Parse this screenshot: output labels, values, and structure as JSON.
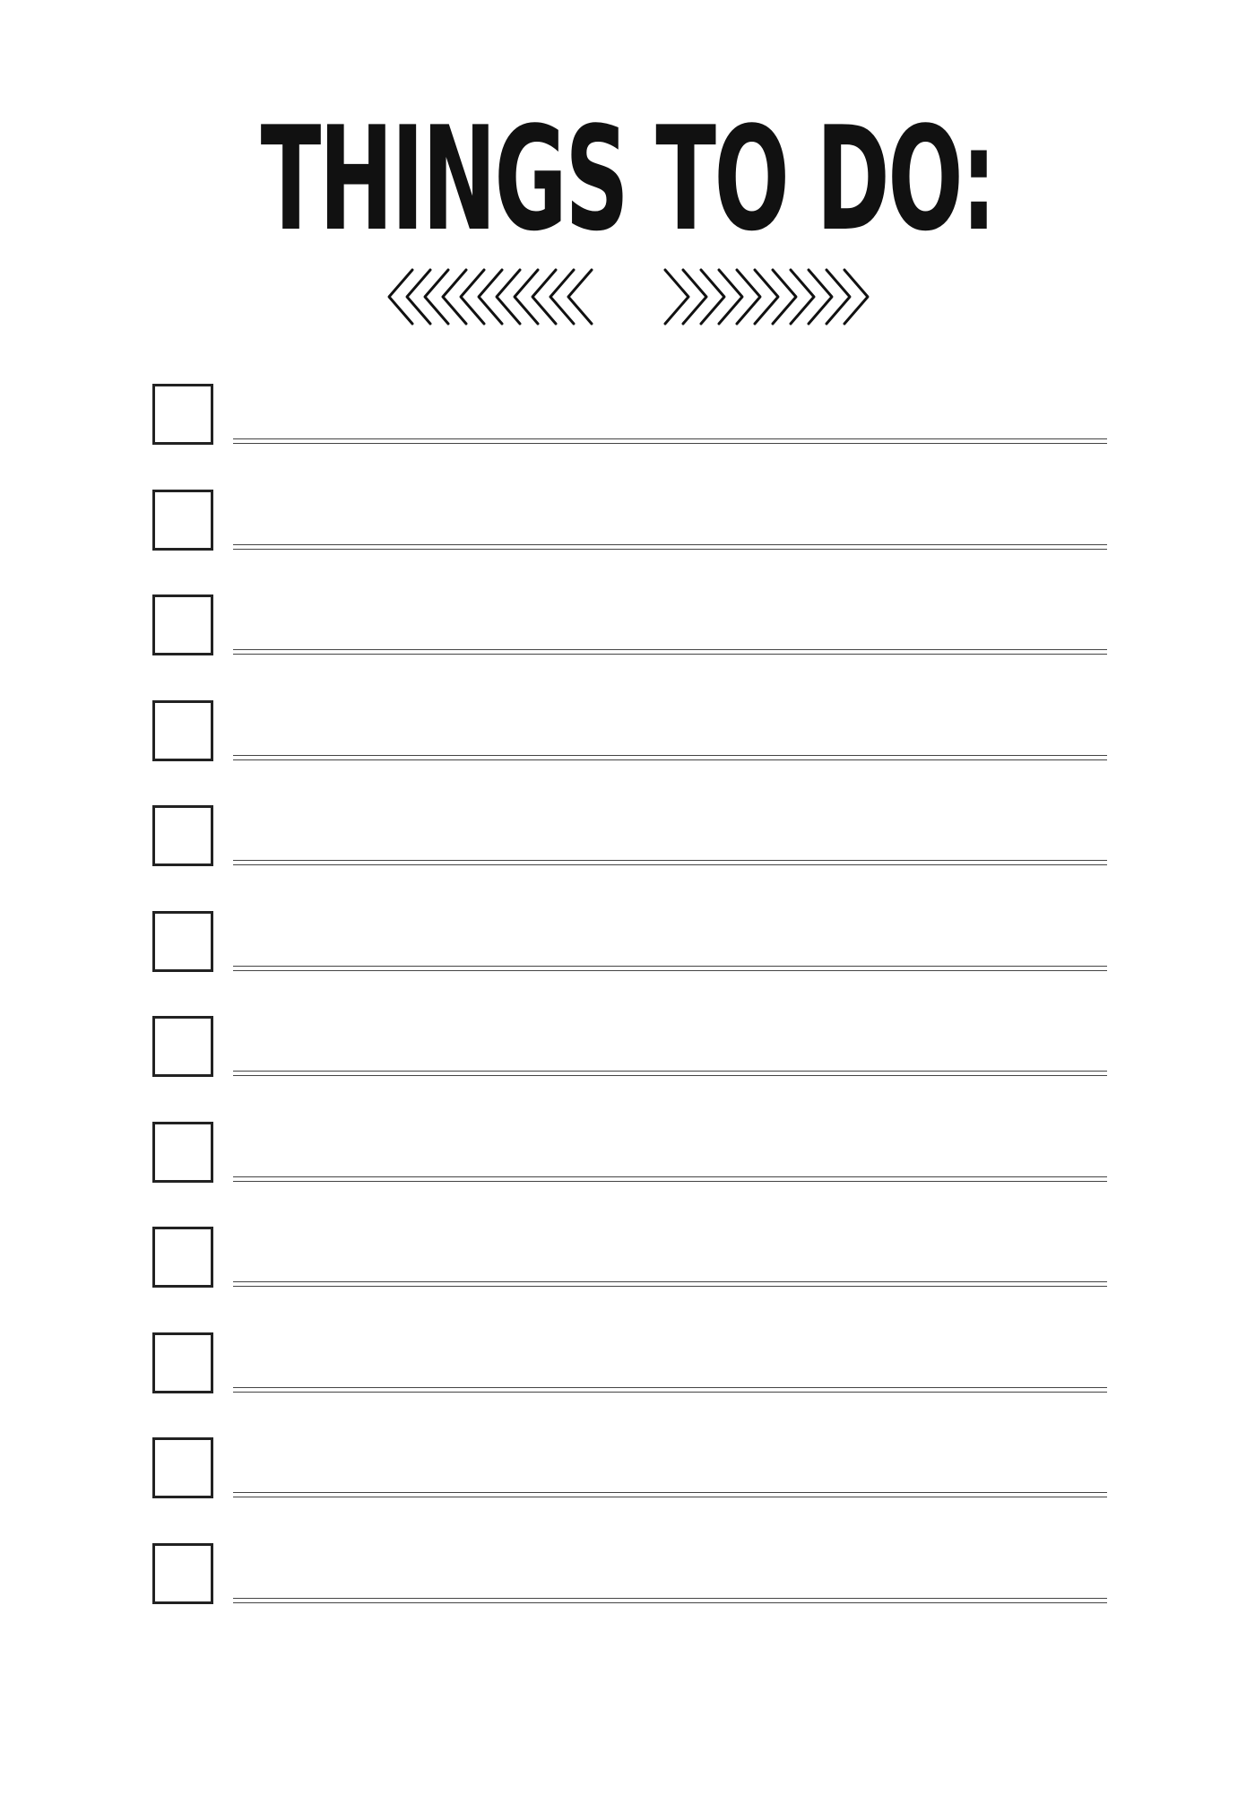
{
  "page": {
    "title": "THINGS TO DO:"
  },
  "ornaments": {
    "left": "chevron-left-icon",
    "right": "chevron-right-icon"
  },
  "todo": {
    "items": [
      {
        "checked": false,
        "text": ""
      },
      {
        "checked": false,
        "text": ""
      },
      {
        "checked": false,
        "text": ""
      },
      {
        "checked": false,
        "text": ""
      },
      {
        "checked": false,
        "text": ""
      },
      {
        "checked": false,
        "text": ""
      },
      {
        "checked": false,
        "text": ""
      },
      {
        "checked": false,
        "text": ""
      },
      {
        "checked": false,
        "text": ""
      },
      {
        "checked": false,
        "text": ""
      },
      {
        "checked": false,
        "text": ""
      },
      {
        "checked": false,
        "text": ""
      }
    ]
  },
  "colors": {
    "ink": "#111111",
    "background": "#ffffff"
  }
}
